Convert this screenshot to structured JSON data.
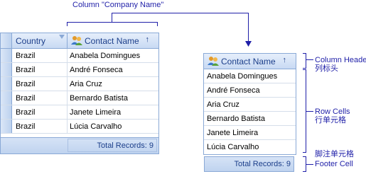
{
  "annotations": {
    "column_company_name": "Column \"Company Name\"",
    "column_header_en": "Column Header",
    "column_header_zh": "列标头",
    "row_cells_en": "Row Cells",
    "row_cells_zh": "行单元格",
    "footer_cell_zh": "脚注单元格",
    "footer_cell_en": "Footer Cell"
  },
  "left_grid": {
    "columns": {
      "country": "Country",
      "contact_name": "Contact Name"
    },
    "rows": [
      {
        "country": "Brazil",
        "contact": "Anabela Domingues"
      },
      {
        "country": "Brazil",
        "contact": "André Fonseca"
      },
      {
        "country": "Brazil",
        "contact": "Aria Cruz"
      },
      {
        "country": "Brazil",
        "contact": "Bernardo Batista"
      },
      {
        "country": "Brazil",
        "contact": "Janete Limeira"
      },
      {
        "country": "Brazil",
        "contact": "Lúcia Carvalho"
      }
    ],
    "footer": "Total Records: 9"
  },
  "right_grid": {
    "header": "Contact Name",
    "rows": [
      "Anabela Domingues",
      "André Fonseca",
      "Aria Cruz",
      "Bernardo Batista",
      "Janete Limeira",
      "Lúcia Carvalho"
    ],
    "footer": "Total Records: 9"
  },
  "icons": {
    "contacts": "people-icon",
    "sort": "sort-ascending-arrow-icon",
    "filter": "filter-icon"
  },
  "colors": {
    "annotation": "#1f1fa8",
    "header_text": "#1b3e8a",
    "grid_border": "#8aa9d6"
  }
}
